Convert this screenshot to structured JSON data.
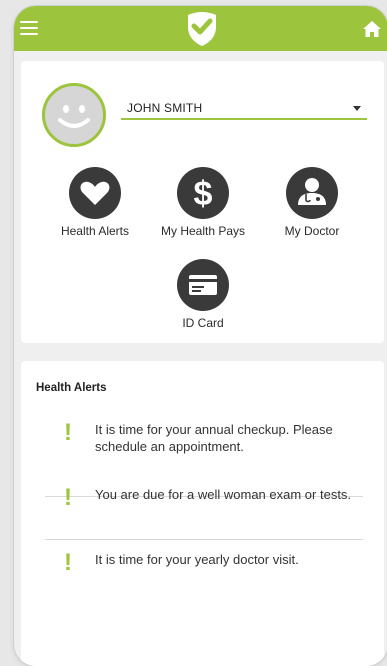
{
  "topbar": {
    "menu_icon": "hamburger-menu-icon",
    "logo_icon": "shield-heart-logo",
    "home_icon": "home-icon",
    "accent": "#9cc43c"
  },
  "user": {
    "name": "JOHN SMITH",
    "avatar_icon": "smiley-avatar"
  },
  "features": [
    {
      "label": "Health Alerts",
      "icon": "heart-icon"
    },
    {
      "label": "My Health Pays",
      "icon": "dollar-icon"
    },
    {
      "label": "My Doctor",
      "icon": "doctor-icon"
    },
    {
      "label": "ID Card",
      "icon": "id-card-icon"
    }
  ],
  "alerts": {
    "title": "Health Alerts",
    "items": [
      {
        "text": "It is time for your annual checkup. Please schedule an appointment."
      },
      {
        "text": "You are due for a well woman exam or tests."
      },
      {
        "text": "It is time for your yearly doctor visit."
      }
    ]
  }
}
